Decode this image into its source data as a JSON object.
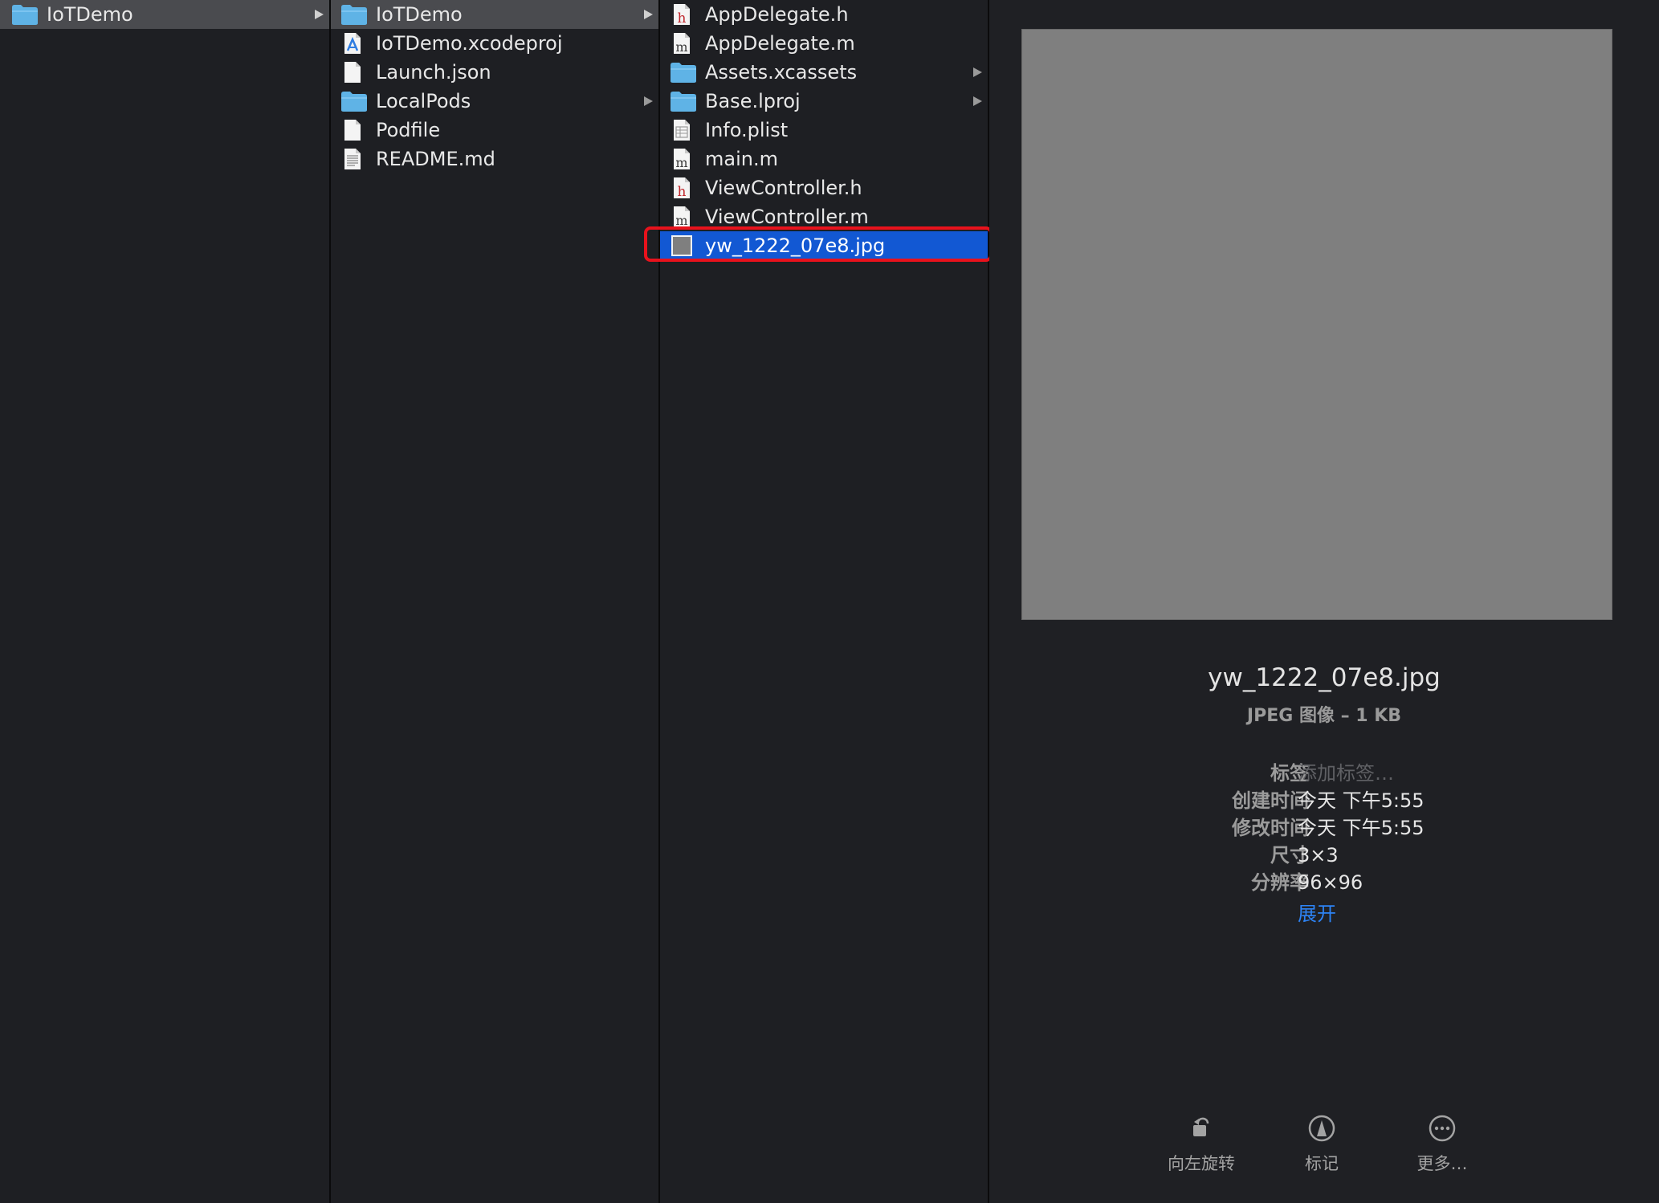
{
  "colors": {
    "background": "#1e1f23",
    "parent_selection": "#4a4b4f",
    "active_selection": "#1258d3",
    "highlight_border": "#e8121c",
    "folder": "#5fb3e6",
    "link": "#2d83f5",
    "thumbnail": "#7f7f7f"
  },
  "columns": [
    {
      "items": [
        {
          "label": "IoTDemo",
          "icon": "folder-icon",
          "has_children": true,
          "state": "parent-selected"
        }
      ]
    },
    {
      "items": [
        {
          "label": "IoTDemo",
          "icon": "folder-icon",
          "has_children": true,
          "state": "parent-selected"
        },
        {
          "label": "IoTDemo.xcodeproj",
          "icon": "xcodeproj-icon",
          "has_children": false,
          "state": ""
        },
        {
          "label": "Launch.json",
          "icon": "document-icon",
          "has_children": false,
          "state": ""
        },
        {
          "label": "LocalPods",
          "icon": "folder-icon",
          "has_children": true,
          "state": ""
        },
        {
          "label": "Podfile",
          "icon": "document-icon",
          "has_children": false,
          "state": ""
        },
        {
          "label": "README.md",
          "icon": "text-document-icon",
          "has_children": false,
          "state": ""
        }
      ]
    },
    {
      "items": [
        {
          "label": "AppDelegate.h",
          "icon": "header-file-icon",
          "has_children": false,
          "state": ""
        },
        {
          "label": "AppDelegate.m",
          "icon": "objc-file-icon",
          "has_children": false,
          "state": ""
        },
        {
          "label": "Assets.xcassets",
          "icon": "folder-icon",
          "has_children": true,
          "state": ""
        },
        {
          "label": "Base.lproj",
          "icon": "folder-icon",
          "has_children": true,
          "state": ""
        },
        {
          "label": "Info.plist",
          "icon": "plist-icon",
          "has_children": false,
          "state": ""
        },
        {
          "label": "main.m",
          "icon": "objc-file-icon",
          "has_children": false,
          "state": ""
        },
        {
          "label": "ViewController.h",
          "icon": "header-file-icon",
          "has_children": false,
          "state": ""
        },
        {
          "label": "ViewController.m",
          "icon": "objc-file-icon",
          "has_children": false,
          "state": ""
        },
        {
          "label": "yw_1222_07e8.jpg",
          "icon": "image-file-icon",
          "has_children": false,
          "state": "selected"
        }
      ]
    }
  ],
  "preview": {
    "file_name": "yw_1222_07e8.jpg",
    "file_kind": "JPEG 图像 – 1 KB",
    "info": [
      {
        "key": "标签",
        "value": "添加标签…",
        "placeholder": true
      },
      {
        "key": "创建时间",
        "value": "今天 下午5:55",
        "placeholder": false
      },
      {
        "key": "修改时间",
        "value": "今天 下午5:55",
        "placeholder": false
      },
      {
        "key": "尺寸",
        "value": "3×3",
        "placeholder": false
      },
      {
        "key": "分辨率",
        "value": "96×96",
        "placeholder": false
      }
    ],
    "expand_label": "展开",
    "actions": {
      "rotate_label": "向左旋转",
      "rotate_icon": "rotate-left-icon",
      "markup_label": "标记",
      "markup_icon": "markup-icon",
      "more_label": "更多…",
      "more_icon": "more-icon"
    }
  }
}
